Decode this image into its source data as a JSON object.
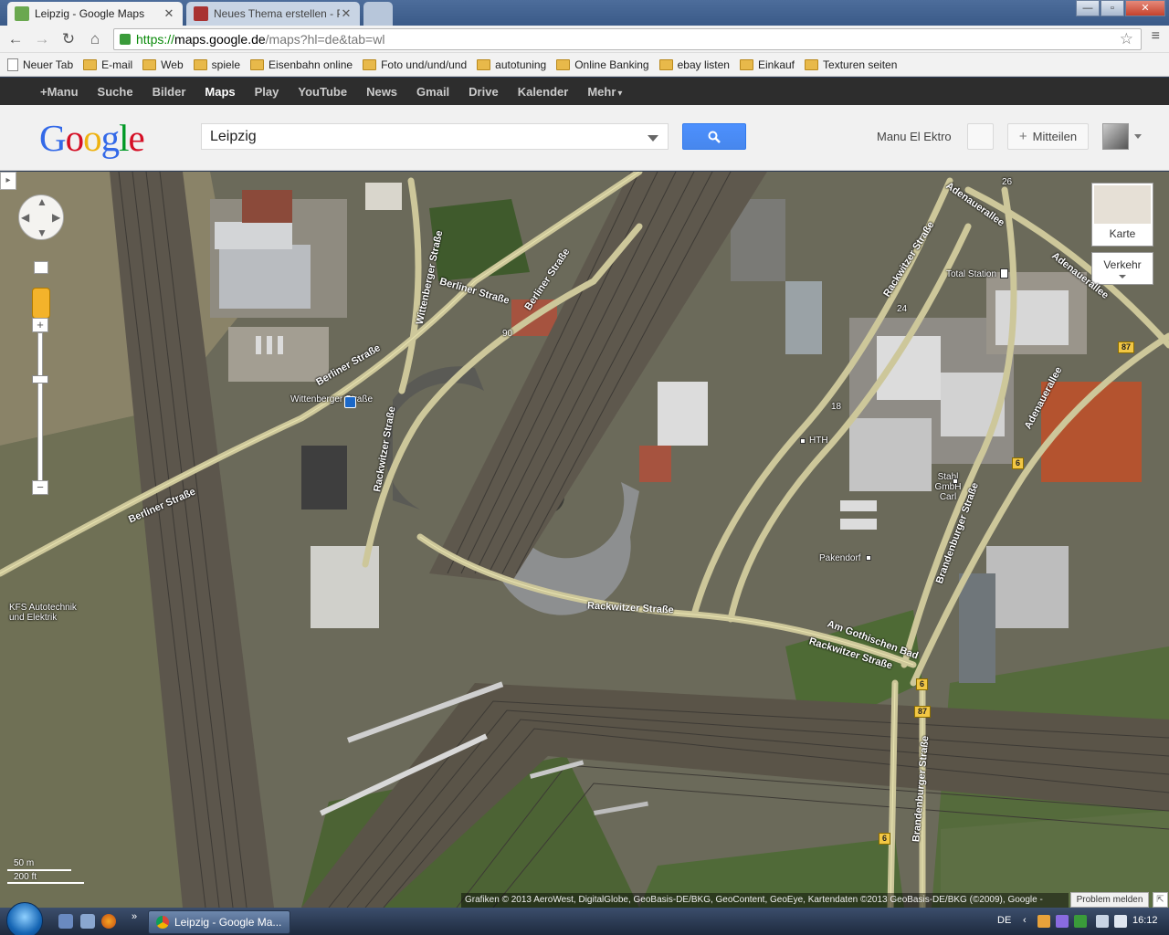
{
  "browser": {
    "tabs": [
      {
        "label": "Leipzig - Google Maps",
        "active": true
      },
      {
        "label": "Neues Thema erstellen - P",
        "active": false
      }
    ],
    "url": {
      "scheme": "https://",
      "host": "maps.google.de",
      "path": "/maps?hl=de&tab=wl"
    },
    "bookmarks": [
      {
        "label": "Neuer Tab",
        "type": "page"
      },
      {
        "label": "E-mail",
        "type": "folder"
      },
      {
        "label": "Web",
        "type": "folder"
      },
      {
        "label": "spiele",
        "type": "folder"
      },
      {
        "label": "Eisenbahn online",
        "type": "folder"
      },
      {
        "label": "Foto und/und/und",
        "type": "folder"
      },
      {
        "label": "autotuning",
        "type": "folder"
      },
      {
        "label": "Online Banking",
        "type": "folder"
      },
      {
        "label": "ebay listen",
        "type": "folder"
      },
      {
        "label": "Einkauf",
        "type": "folder"
      },
      {
        "label": "Texturen seiten",
        "type": "folder"
      }
    ]
  },
  "gbar": {
    "items": [
      "+Manu",
      "Suche",
      "Bilder",
      "Maps",
      "Play",
      "YouTube",
      "News",
      "Gmail",
      "Drive",
      "Kalender",
      "Mehr"
    ],
    "active": "Maps",
    "more_caret": "▾"
  },
  "header": {
    "logo": [
      "G",
      "o",
      "o",
      "g",
      "l",
      "e"
    ],
    "logo_colors": [
      "#3369e8",
      "#d50f25",
      "#eeb211",
      "#3369e8",
      "#009925",
      "#d50f25"
    ],
    "search_value": "Leipzig",
    "search_icon": "magnifier-icon",
    "username": "Manu El Ektro",
    "share_label": "Mitteilen",
    "share_plus": "+"
  },
  "map": {
    "type_button": "Karte",
    "traffic_button": "Verkehr",
    "scale": {
      "metric": "50 m",
      "imperial": "200 ft"
    },
    "copyright": "Grafiken © 2013 AeroWest, DigitalGlobe, GeoBasis-DE/BKG, GeoContent, GeoEye, Kartendaten ©2013 GeoBasis-DE/BKG (©2009), Google -",
    "report_problem": "Problem melden",
    "street_labels": [
      "Berliner Straße",
      "Berliner Straße",
      "Berliner Straße",
      "Berliner Straße",
      "Wittenberger Straße",
      "Rackwitzer Straße",
      "Rackwitzer Straße",
      "Rackwitzer Straße",
      "Rackwitzer Straße",
      "Am Gothischen Bad",
      "Brandenburger Straße",
      "Brandenburger Straße",
      "Adenauerallee",
      "Adenauerallee",
      "Adenauerallee"
    ],
    "poi_labels": [
      "Wittenberger Straße",
      "KFS Autotechnik und Elektrik",
      "Total Station",
      "HTH",
      "Stahl GmbH Carl",
      "Pakendorf"
    ],
    "route_shields": [
      "87",
      "87",
      "6",
      "6",
      "6",
      "90",
      "18",
      "24",
      "26"
    ]
  },
  "taskbar": {
    "task_label": "Leipzig - Google Ma...",
    "language": "DE",
    "time": "16:12",
    "quicklaunch_more": "»"
  },
  "window_buttons": {
    "minimize": "—",
    "maximize": "▫",
    "close": "✕"
  }
}
